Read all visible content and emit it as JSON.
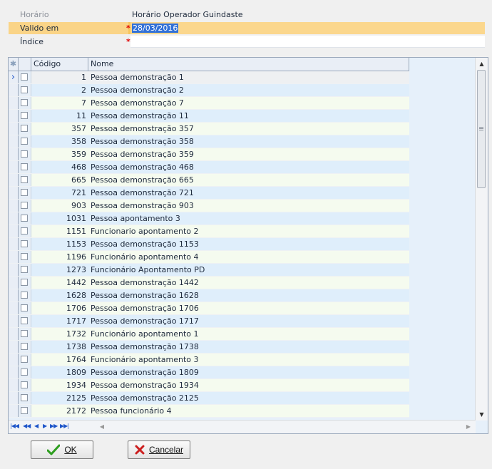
{
  "form": {
    "horario": {
      "label": "Horário",
      "value": "Horário Operador Guindaste"
    },
    "valido_em": {
      "label": "Valido em",
      "value": "28/03/2016",
      "required_mark": "*"
    },
    "indice": {
      "label": "Índice",
      "value": "",
      "required_mark": "*"
    }
  },
  "grid": {
    "columns": {
      "selector_icon": "asterisk-icon",
      "code": "Código",
      "name": "Nome"
    },
    "rows": [
      {
        "code": "1",
        "name": "Pessoa demonstração 1"
      },
      {
        "code": "2",
        "name": "Pessoa demonstração 2"
      },
      {
        "code": "7",
        "name": "Pessoa demonstração 7"
      },
      {
        "code": "11",
        "name": "Pessoa demonstração 11"
      },
      {
        "code": "357",
        "name": "Pessoa demonstração 357"
      },
      {
        "code": "358",
        "name": "Pessoa demonstração 358"
      },
      {
        "code": "359",
        "name": "Pessoa demonstração 359"
      },
      {
        "code": "468",
        "name": "Pessoa demonstração 468"
      },
      {
        "code": "665",
        "name": "Pessoa demonstração 665"
      },
      {
        "code": "721",
        "name": "Pessoa demonstração 721"
      },
      {
        "code": "903",
        "name": "Pessoa demonstração 903"
      },
      {
        "code": "1031",
        "name": "Pessoa apontamento 3"
      },
      {
        "code": "1151",
        "name": "Funcionario apontamento 2"
      },
      {
        "code": "1153",
        "name": "Pessoa demonstração 1153"
      },
      {
        "code": "1196",
        "name": "Funcionário apontamento 4"
      },
      {
        "code": "1273",
        "name": "Funcionário Apontamento PD"
      },
      {
        "code": "1442",
        "name": "Pessoa demonstração 1442"
      },
      {
        "code": "1628",
        "name": "Pessoa demonstração 1628"
      },
      {
        "code": "1706",
        "name": "Pessoa demonstração 1706"
      },
      {
        "code": "1717",
        "name": "Pessoa demonstração 1717"
      },
      {
        "code": "1732",
        "name": "Funcionário apontamento 1"
      },
      {
        "code": "1738",
        "name": "Pessoa demonstração 1738"
      },
      {
        "code": "1764",
        "name": "Funcionário apontamento 3"
      },
      {
        "code": "1809",
        "name": "Pessoa demonstração 1809"
      },
      {
        "code": "1934",
        "name": "Pessoa demonstração 1934"
      },
      {
        "code": "2125",
        "name": "Pessoa demonstração 2125"
      },
      {
        "code": "2172",
        "name": "Pessoa funcionário 4"
      }
    ],
    "navigator_icons": [
      "first-page-icon",
      "prev-page-icon",
      "prev-row-icon",
      "next-row-icon",
      "next-page-icon",
      "last-page-icon"
    ]
  },
  "buttons": {
    "ok": {
      "label": "OK",
      "icon": "checkmark-icon",
      "color": "#2e9e1f"
    },
    "cancel": {
      "label": "Cancelar",
      "icon": "x-icon",
      "color": "#cc1f1f"
    }
  },
  "colors": {
    "highlight_row": "#f7c55e",
    "selection": "#3070d8",
    "grid_link_text": "#1f56c9"
  }
}
